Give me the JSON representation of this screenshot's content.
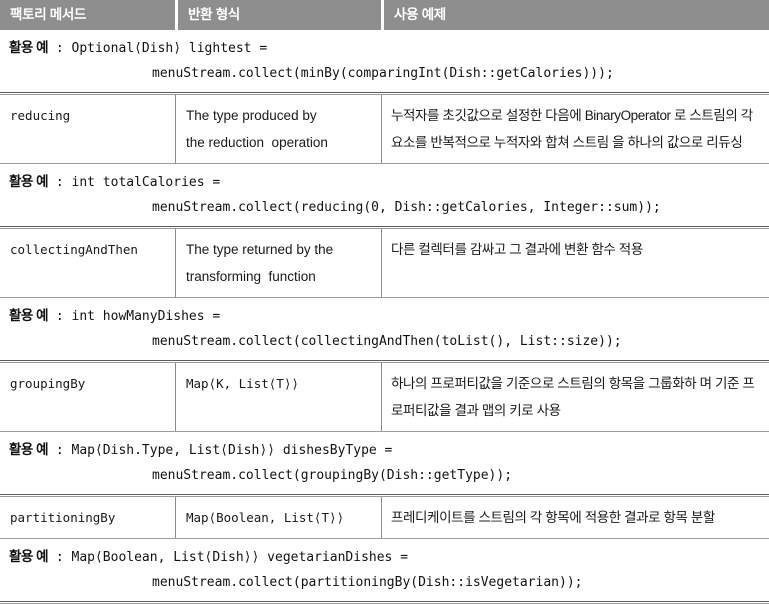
{
  "table": {
    "headers": [
      {
        "label": "팩토리 메서드"
      },
      {
        "label": "반환 형식"
      },
      {
        "label": "사용 예제"
      }
    ],
    "example_label": "활용 예",
    "rows": [
      {
        "kind": "example",
        "line1_label": "활용 예",
        "line1_code": " : Optional⟨Dish⟩ lightest =",
        "line2_code": "menuStream.collect(minBy(comparingInt(Dish::getCalories)));"
      },
      {
        "kind": "data",
        "method": "reducing",
        "return_type_l1": "The type produced by",
        "return_type_l2": "the reduction  operation",
        "usage": "누적자를 초깃값으로 설정한 다음에 BinaryOperator 로 스트림의 각 요소를 반복적으로 누적자와 합쳐 스트림 을 하나의 값으로 리듀싱"
      },
      {
        "kind": "example",
        "line1_label": "활용 예",
        "line1_code": " : int totalCalories =",
        "line2_code": "menuStream.collect(reducing(0, Dish::getCalories, Integer::sum));"
      },
      {
        "kind": "data",
        "method": "collectingAndThen",
        "return_type_l1": "The type returned by the",
        "return_type_l2": "transforming  function",
        "usage": "다른 컬렉터를 감싸고 그 결과에 변환 함수 적용"
      },
      {
        "kind": "example",
        "line1_label": "활용 예",
        "line1_code": " : int howManyDishes =",
        "line2_code": "menuStream.collect(collectingAndThen(toList(), List::size));"
      },
      {
        "kind": "data",
        "method": "groupingBy",
        "return_type_l1": "Map⟨K, List⟨T⟩⟩",
        "return_type_l2": "",
        "usage": "하나의 프로퍼티값을 기준으로 스트림의 항목을 그룹화하 며 기준 프로퍼티값을 결과 맵의 키로 사용"
      },
      {
        "kind": "example",
        "line1_label": "활용 예",
        "line1_code": " : Map⟨Dish.Type, List⟨Dish⟩⟩ dishesByType =",
        "line2_code": "menuStream.collect(groupingBy(Dish::getType));"
      },
      {
        "kind": "data",
        "method": "partitioningBy",
        "return_type_l1": "Map⟨Boolean, List⟨T⟩⟩",
        "return_type_l2": "",
        "usage": "프레디케이트를 스트림의 각 항목에 적용한 결과로 항목 분할"
      },
      {
        "kind": "example",
        "line1_label": "활용 예",
        "line1_code": " : Map⟨Boolean, List⟨Dish⟩⟩ vegetarianDishes =",
        "line2_code": "menuStream.collect(partitioningBy(Dish::isVegetarian));"
      }
    ]
  },
  "colors": {
    "header_background": "#8e8e8e",
    "header_text": "#ffffff",
    "rule": "#5e5e5e",
    "text": "#1a1a1a"
  }
}
